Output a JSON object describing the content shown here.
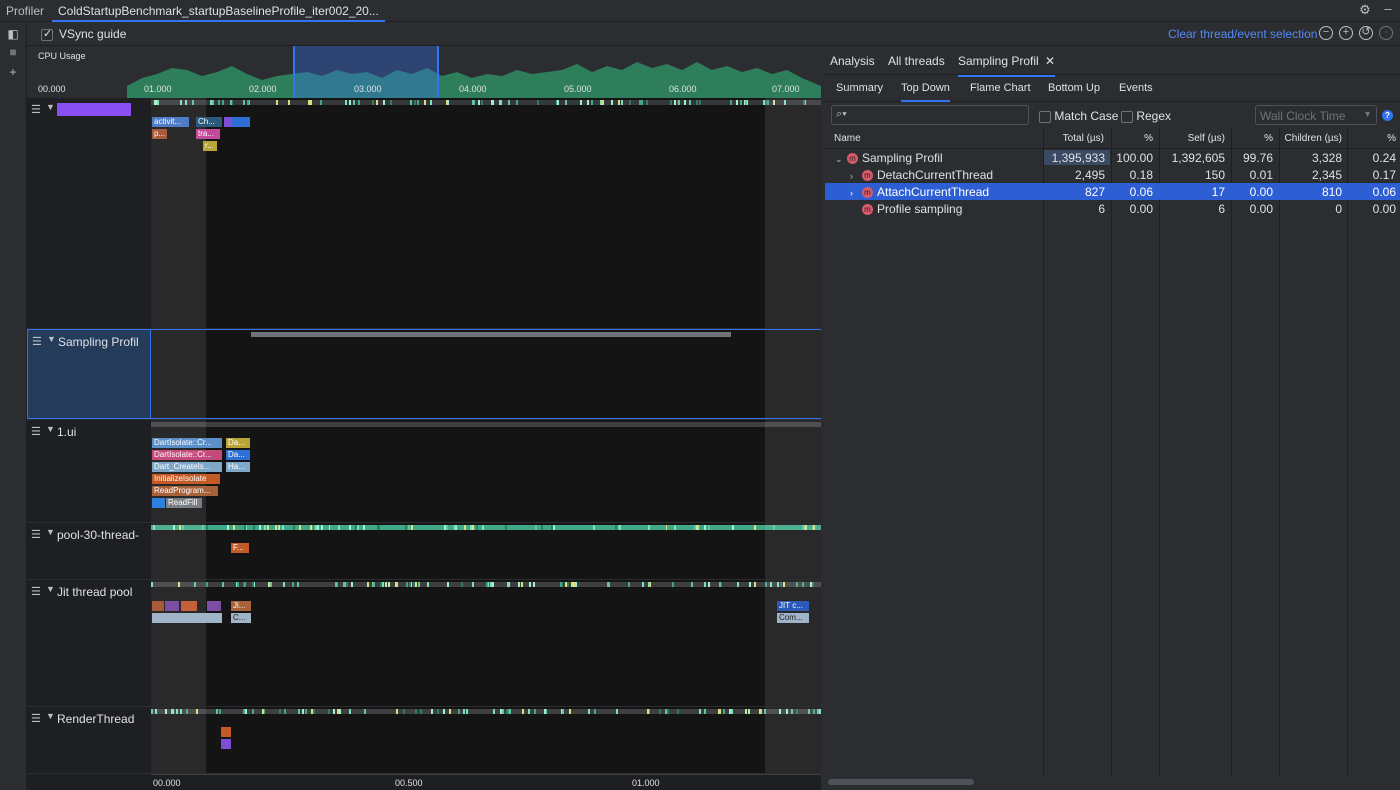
{
  "titlebar": {
    "app_label": "Profiler",
    "file_tab": "ColdStartupBenchmark_startupBaselineProfile_iter002_20...",
    "settings_icon": "gear-icon",
    "minimize_icon": "minimize-icon"
  },
  "toolbar": {
    "vsync_label": "VSync guide",
    "vsync_checked": true,
    "clear_selection": "Clear thread/event selection"
  },
  "cpu": {
    "label": "CPU Usage",
    "ticks": [
      "00.000",
      "01.000",
      "02.000",
      "03.000",
      "04.000",
      "05.000",
      "06.000",
      "07.000"
    ]
  },
  "threads": [
    {
      "name": "",
      "color_swatch": "#8a4ff0"
    },
    {
      "name": "Sampling Profil"
    },
    {
      "name": "1.ui"
    },
    {
      "name": "pool-30-thread-"
    },
    {
      "name": "Jit thread pool"
    },
    {
      "name": "RenderThread"
    }
  ],
  "frames": {
    "main": [
      "activit...",
      "Ch...",
      "p...",
      "tra...",
      "r..."
    ],
    "ui": [
      "DartIsolate::Cr...",
      "Da...",
      "DartIsolate::Cr...",
      "Da...",
      "Dart_CreateIs...",
      "Ha...",
      "InitializeIsolate",
      "ReadProgram...",
      "ReadFill"
    ],
    "pool": [
      "F..."
    ],
    "jit": [
      "Ji...",
      "C...",
      "JIT c...",
      "Com..."
    ]
  },
  "timeaxis": [
    "00.000",
    "00.500",
    "01.000"
  ],
  "analysis": {
    "tabs": [
      "Analysis",
      "All threads",
      "Sampling Profil"
    ],
    "subtabs": [
      "Summary",
      "Top Down",
      "Flame Chart",
      "Bottom Up",
      "Events"
    ],
    "search_placeholder": "",
    "match_case": "Match Case",
    "regex": "Regex",
    "clock": "Wall Clock Time",
    "columns": [
      "Name",
      "Total (µs)",
      "%",
      "Self (µs)",
      "%",
      "Children (µs)",
      "%"
    ],
    "rows": [
      {
        "name": "Sampling Profil",
        "total": "1,395,933",
        "total_pct": "100.00",
        "self": "1,392,605",
        "self_pct": "99.76",
        "children": "3,328",
        "children_pct": "0.24",
        "expanded": true
      },
      {
        "name": "DetachCurrentThread",
        "total": "2,495",
        "total_pct": "0.18",
        "self": "150",
        "self_pct": "0.01",
        "children": "2,345",
        "children_pct": "0.17"
      },
      {
        "name": "AttachCurrentThread",
        "total": "827",
        "total_pct": "0.06",
        "self": "17",
        "self_pct": "0.00",
        "children": "810",
        "children_pct": "0.06",
        "selected": true
      },
      {
        "name": "Profile sampling",
        "total": "6",
        "total_pct": "0.00",
        "self": "6",
        "self_pct": "0.00",
        "children": "0",
        "children_pct": "0.00"
      }
    ]
  },
  "colors": {
    "accent": "#3574f0",
    "method_icon": "#d85b6b",
    "selected_row": "#2e5ed4"
  }
}
